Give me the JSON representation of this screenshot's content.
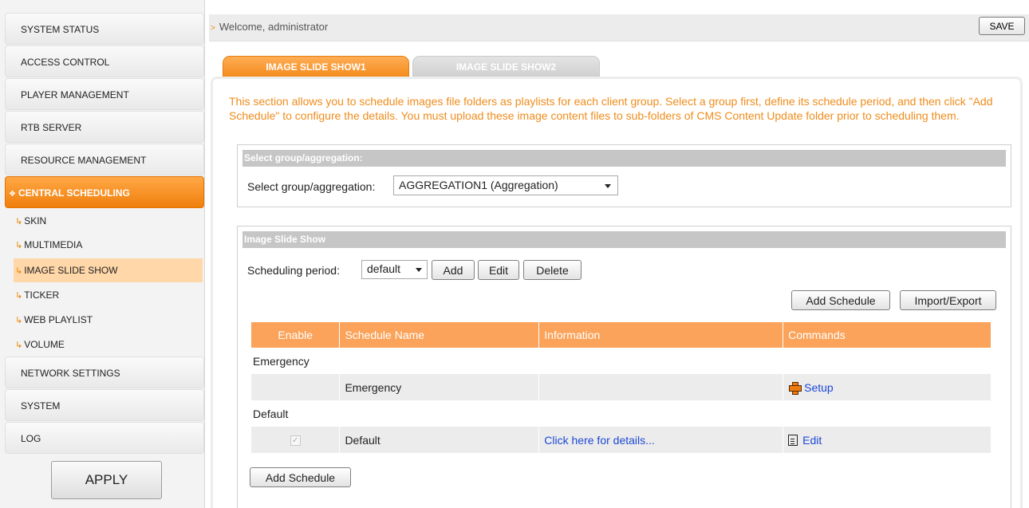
{
  "sidebar": {
    "items": [
      {
        "label": "SYSTEM STATUS"
      },
      {
        "label": "ACCESS CONTROL"
      },
      {
        "label": "PLAYER MANAGEMENT"
      },
      {
        "label": "RTB SERVER"
      },
      {
        "label": "RESOURCE MANAGEMENT"
      },
      {
        "label": "CENTRAL SCHEDULING",
        "active": true
      },
      {
        "label": "NETWORK SETTINGS"
      },
      {
        "label": "SYSTEM"
      },
      {
        "label": "LOG"
      }
    ],
    "subitems": [
      {
        "label": "SKIN"
      },
      {
        "label": "MULTIMEDIA"
      },
      {
        "label": "IMAGE SLIDE SHOW",
        "active": true
      },
      {
        "label": "TICKER"
      },
      {
        "label": "WEB PLAYLIST"
      },
      {
        "label": "VOLUME"
      }
    ],
    "apply_label": "APPLY"
  },
  "topbar": {
    "welcome": "Welcome, administrator",
    "save_label": "SAVE"
  },
  "tabs": [
    {
      "label": "IMAGE SLIDE SHOW1",
      "active": true
    },
    {
      "label": "IMAGE SLIDE SHOW2",
      "active": false
    }
  ],
  "intro_text": "This section allows you to schedule images file folders as playlists for each client group. Select a group first, define its schedule period, and then click \"Add Schedule\" to configure the details. You must upload these image content files to sub-folders of CMS Content Update folder prior to scheduling them.",
  "group_section": {
    "header": "Select group/aggregation:",
    "label": "Select group/aggregation:",
    "selected": "AGGREGATION1 (Aggregation)"
  },
  "slide_section": {
    "header": "Image Slide Show",
    "period_label": "Scheduling period:",
    "period_selected": "default",
    "add_label": "Add",
    "edit_label": "Edit",
    "delete_label": "Delete",
    "add_schedule_label": "Add Schedule",
    "import_export_label": "Import/Export",
    "add_schedule_bottom_label": "Add Schedule"
  },
  "table": {
    "columns": [
      "Enable",
      "Schedule Name",
      "Information",
      "Commands"
    ],
    "groups": [
      {
        "group": "Emergency",
        "row": {
          "enabled": false,
          "name": "Emergency",
          "info": "",
          "command": "Setup",
          "command_icon": "plus-icon"
        }
      },
      {
        "group": "Default",
        "row": {
          "enabled": true,
          "name": "Default",
          "info": "Click here for details...",
          "command": "Edit",
          "command_icon": "document-icon"
        }
      }
    ]
  },
  "colors": {
    "accent": "#f48a1c",
    "table_header": "#fba35a",
    "link": "#1c48d6"
  }
}
